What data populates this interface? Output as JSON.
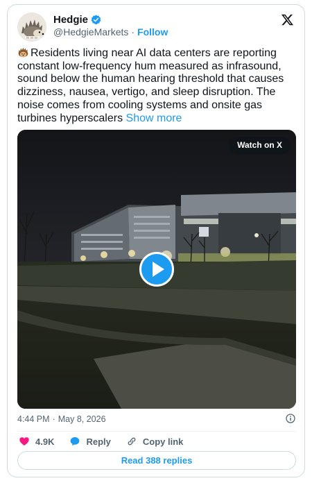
{
  "author": {
    "name": "Hedgie",
    "handle": "@HedgieMarkets",
    "separator": "·",
    "follow_label": "Follow"
  },
  "tweet": {
    "text": "Residents living near AI data centers are reporting constant low-frequency hum measured as infrasound, sound below the human hearing threshold that causes dizziness, nausea, vertigo, and sleep disruption. The noise comes from cooling systems and onsite gas turbines hyperscalers",
    "show_more_label": "Show more"
  },
  "media": {
    "watch_label": "Watch on X"
  },
  "meta": {
    "time": "4:44 PM",
    "separator": "·",
    "date": "May 8, 2026"
  },
  "actions": {
    "likes": "4.9K",
    "reply_label": "Reply",
    "copy_link_label": "Copy link"
  },
  "replies_button": "Read 388 replies",
  "colors": {
    "accent": "#1d9bf0",
    "like": "#f91880",
    "muted": "#536471"
  }
}
